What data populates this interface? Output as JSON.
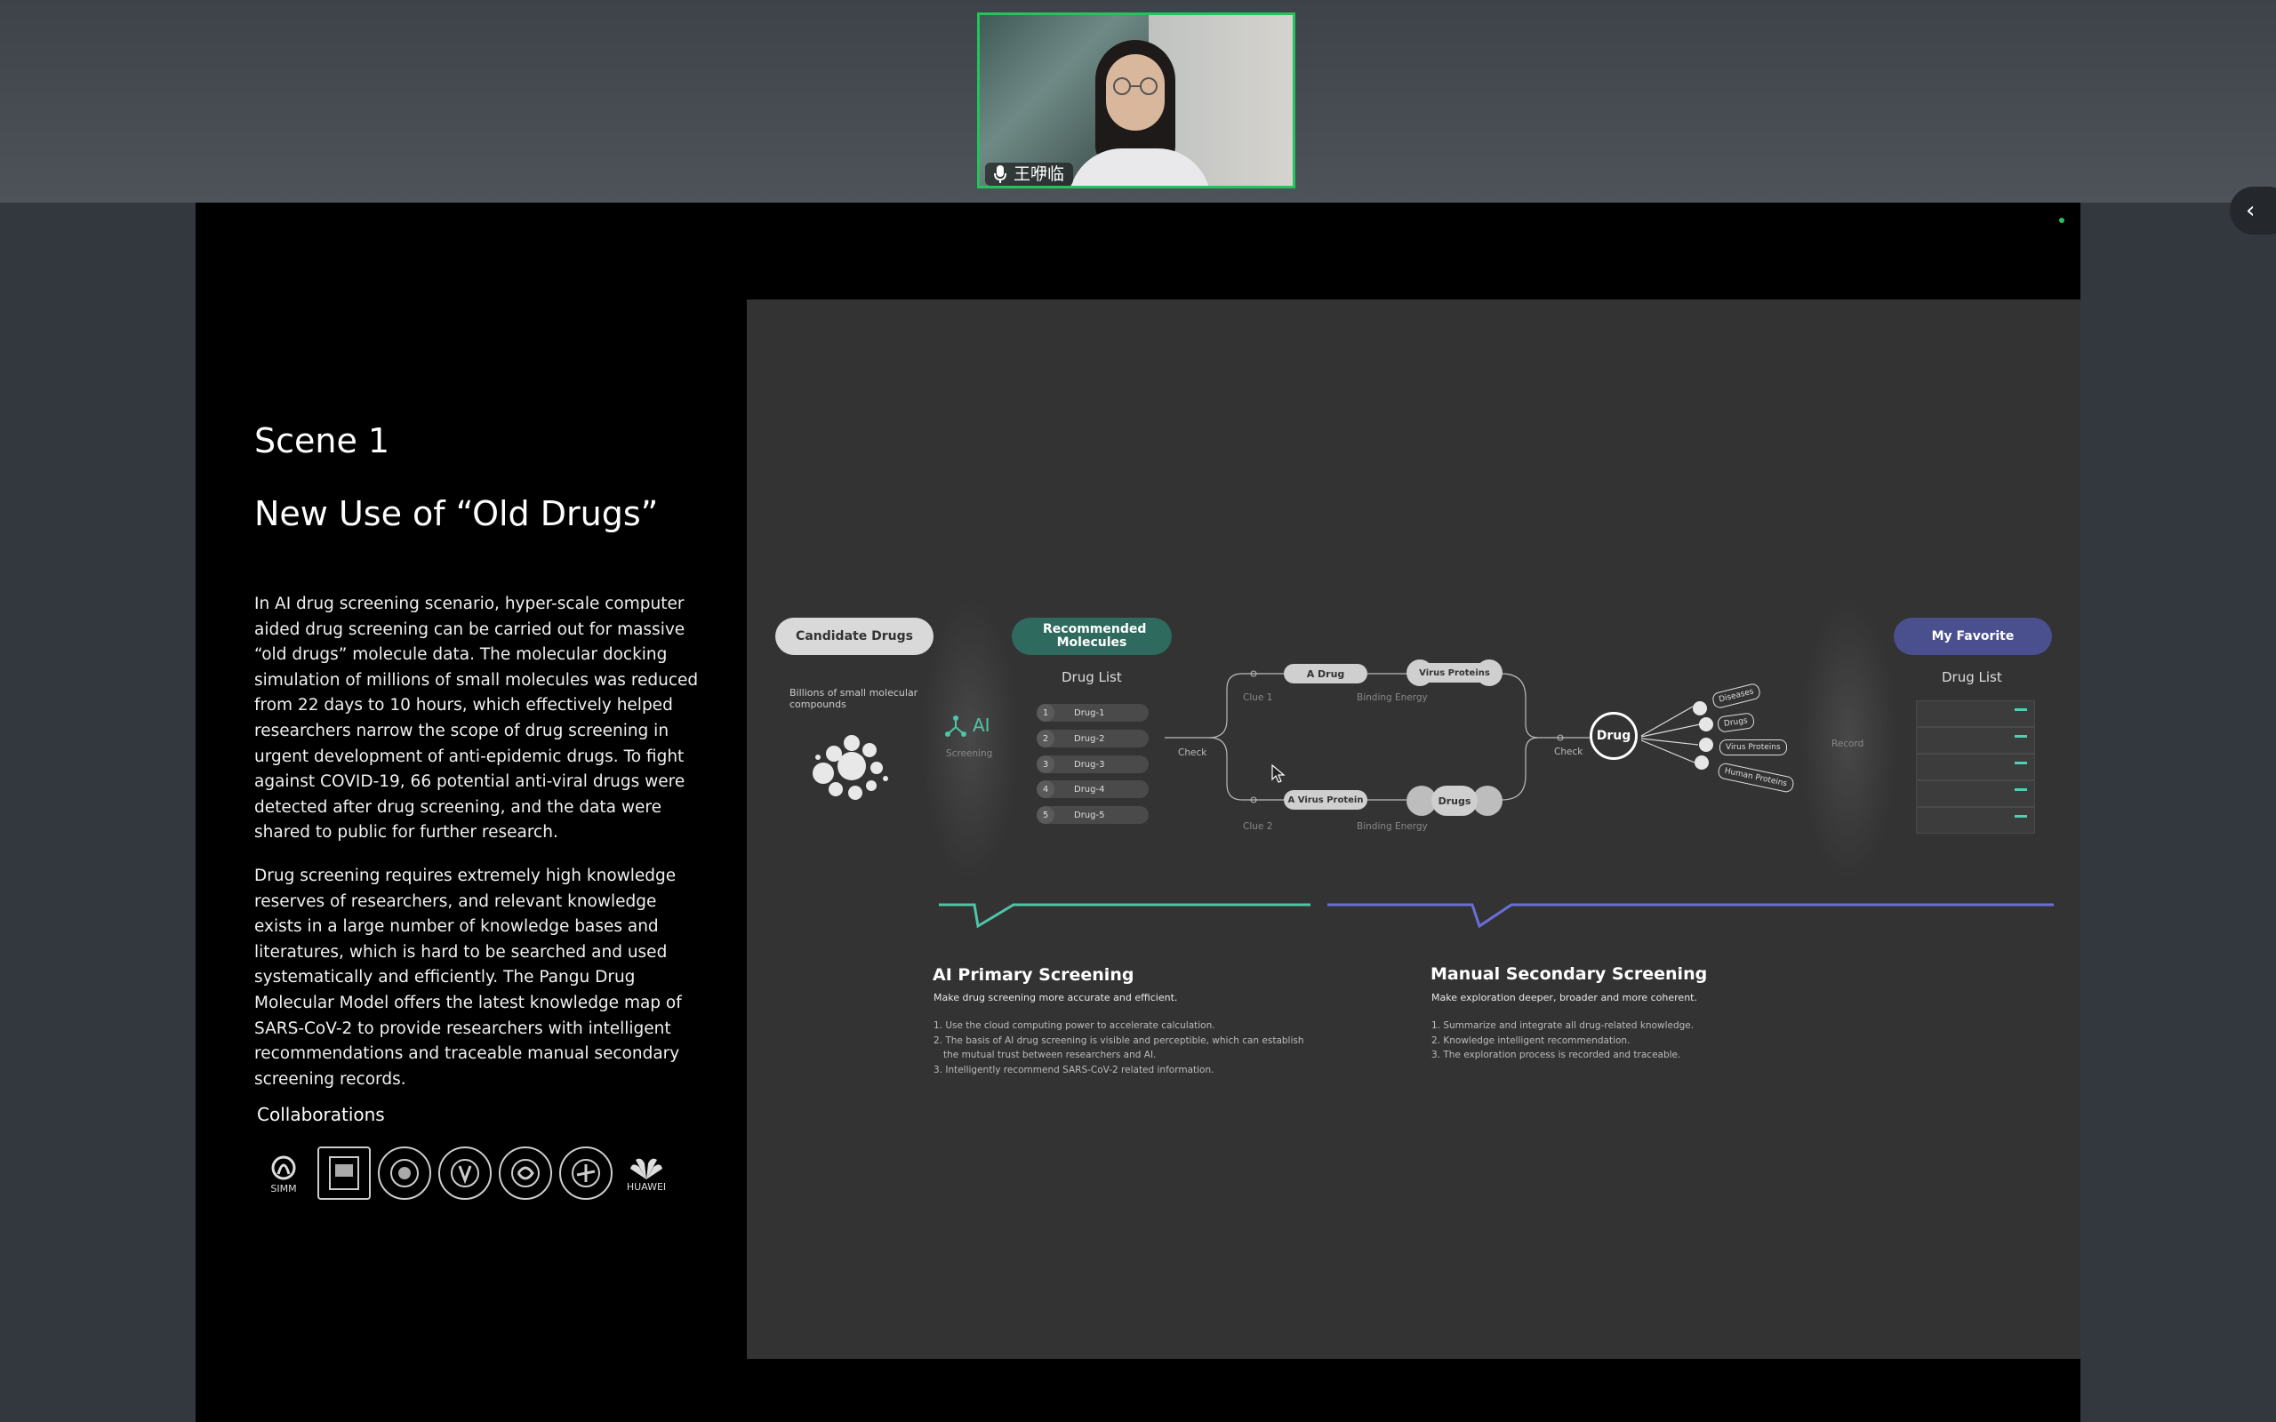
{
  "meeting": {
    "participant_name": "王咿临",
    "mic_icon": "microphone-icon",
    "sidebar_toggle_glyph": "‹"
  },
  "slide": {
    "scene": "Scene 1",
    "heading": "New Use of “Old Drugs”",
    "paragraph1": "In AI drug screening scenario, hyper-scale computer aided drug screening can be carried out for massive “old drugs” molecule data. The molecular docking simulation of millions of small molecules was reduced from 22 days to 10 hours, which effectively helped researchers narrow the scope of drug screening in urgent development of anti-epidemic drugs. To fight against COVID-19, 66 potential anti-viral drugs were detected after drug screening, and the data were shared to public for further research.",
    "paragraph2": "Drug screening requires extremely high knowledge reserves of researchers, and relevant knowledge exists in a large number of knowledge bases and literatures, which is hard to be searched and used systematically and efficiently. The Pangu Drug Molecular Model offers the latest knowledge map of SARS-CoV-2 to provide researchers with intelligent recommendations and traceable manual secondary screening records.",
    "collab_title": "Collaborations",
    "logos": {
      "simm": "SIMM",
      "huawei": "HUAWEI"
    }
  },
  "diagram": {
    "candidate": "Candidate Drugs",
    "candidate_desc": "Billions of small molecular compounds",
    "ai_label": "AI",
    "screening": "Screening",
    "recommended": "Recommended Molecules",
    "drug_list": "Drug List",
    "drugs": [
      {
        "num": "1",
        "name": "Drug-1"
      },
      {
        "num": "2",
        "name": "Drug-2"
      },
      {
        "num": "3",
        "name": "Drug-3"
      },
      {
        "num": "4",
        "name": "Drug-4"
      },
      {
        "num": "5",
        "name": "Drug-5"
      }
    ],
    "check": "Check",
    "a_drug": "A Drug",
    "virus_proteins": "Virus Proteins",
    "clue1": "Clue 1",
    "binding_energy": "Binding Energy",
    "a_virus_protein": "A Virus Protein",
    "drugs_label": "Drugs",
    "clue2": "Clue 2",
    "drug_center": "Drug",
    "tags": [
      "Diseases",
      "Drugs",
      "Virus Proteins",
      "Human Proteins"
    ],
    "record": "Record",
    "my_favorite": "My Favorite",
    "fav_drug_list": "Drug List",
    "ai_section": {
      "title": "AI Primary Screening",
      "subtitle": "Make drug screening more accurate and efficient.",
      "items": [
        "1. Use the cloud computing power to accelerate calculation.",
        "2. The basis of AI drug screening is visible and perceptible, which can establish",
        "the mutual trust between researchers and AI.",
        "3. Intelligently recommend SARS-CoV-2 related information."
      ]
    },
    "manual_section": {
      "title": "Manual Secondary Screening",
      "subtitle": "Make exploration deeper, broader and more coherent.",
      "items": [
        "1. Summarize and integrate all drug-related knowledge.",
        "2. Knowledge intelligent recommendation.",
        "3. The exploration process is recorded and traceable."
      ]
    },
    "colors": {
      "recommended": "#2e6a5e",
      "favorite": "#4a4f8e",
      "ai_line": "#4ec5a6",
      "manual_line": "#6a6fd8"
    }
  }
}
